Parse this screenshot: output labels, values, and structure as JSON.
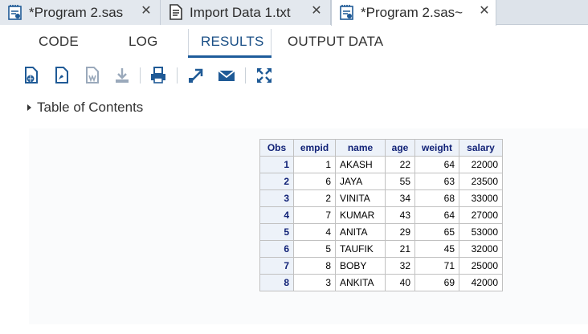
{
  "file_tabs": [
    {
      "label": "*Program 2.sas",
      "close": "✕",
      "icon": "sas-program-icon"
    },
    {
      "label": "Import Data 1.txt",
      "close": "✕",
      "icon": "text-file-icon"
    },
    {
      "label": "*Program 2.sas~",
      "close": "✕",
      "icon": "sas-program-icon"
    }
  ],
  "section_tabs": [
    "CODE",
    "LOG",
    "RESULTS",
    "OUTPUT DATA"
  ],
  "active_section_tab": "RESULTS",
  "toolbar_icons": [
    "download-html-icon",
    "download-pdf-icon",
    "download-rtf-icon",
    "download-icon",
    "print-icon",
    "open-in-new-window-icon",
    "email-icon",
    "maximize-icon"
  ],
  "toc": {
    "label": "Table of Contents"
  },
  "table": {
    "headers": [
      "Obs",
      "empid",
      "name",
      "age",
      "weight",
      "salary"
    ],
    "rows": [
      {
        "obs": "1",
        "empid": "1",
        "name": "AKASH",
        "age": "22",
        "weight": "64",
        "salary": "22000"
      },
      {
        "obs": "2",
        "empid": "6",
        "name": "JAYA",
        "age": "55",
        "weight": "63",
        "salary": "23500"
      },
      {
        "obs": "3",
        "empid": "2",
        "name": "VINITA",
        "age": "34",
        "weight": "68",
        "salary": "33000"
      },
      {
        "obs": "4",
        "empid": "7",
        "name": "KUMAR",
        "age": "43",
        "weight": "64",
        "salary": "27000"
      },
      {
        "obs": "5",
        "empid": "4",
        "name": "ANITA",
        "age": "29",
        "weight": "65",
        "salary": "53000"
      },
      {
        "obs": "6",
        "empid": "5",
        "name": "TAUFIK",
        "age": "21",
        "weight": "45",
        "salary": "32000"
      },
      {
        "obs": "7",
        "empid": "8",
        "name": "BOBY",
        "age": "32",
        "weight": "71",
        "salary": "25000"
      },
      {
        "obs": "8",
        "empid": "3",
        "name": "ANKITA",
        "age": "40",
        "weight": "69",
        "salary": "42000"
      }
    ]
  },
  "colors": {
    "accent": "#1e5c9b",
    "header_text": "#112277",
    "header_bg": "#edf2f9",
    "icon_blue": "#1f5a96"
  }
}
